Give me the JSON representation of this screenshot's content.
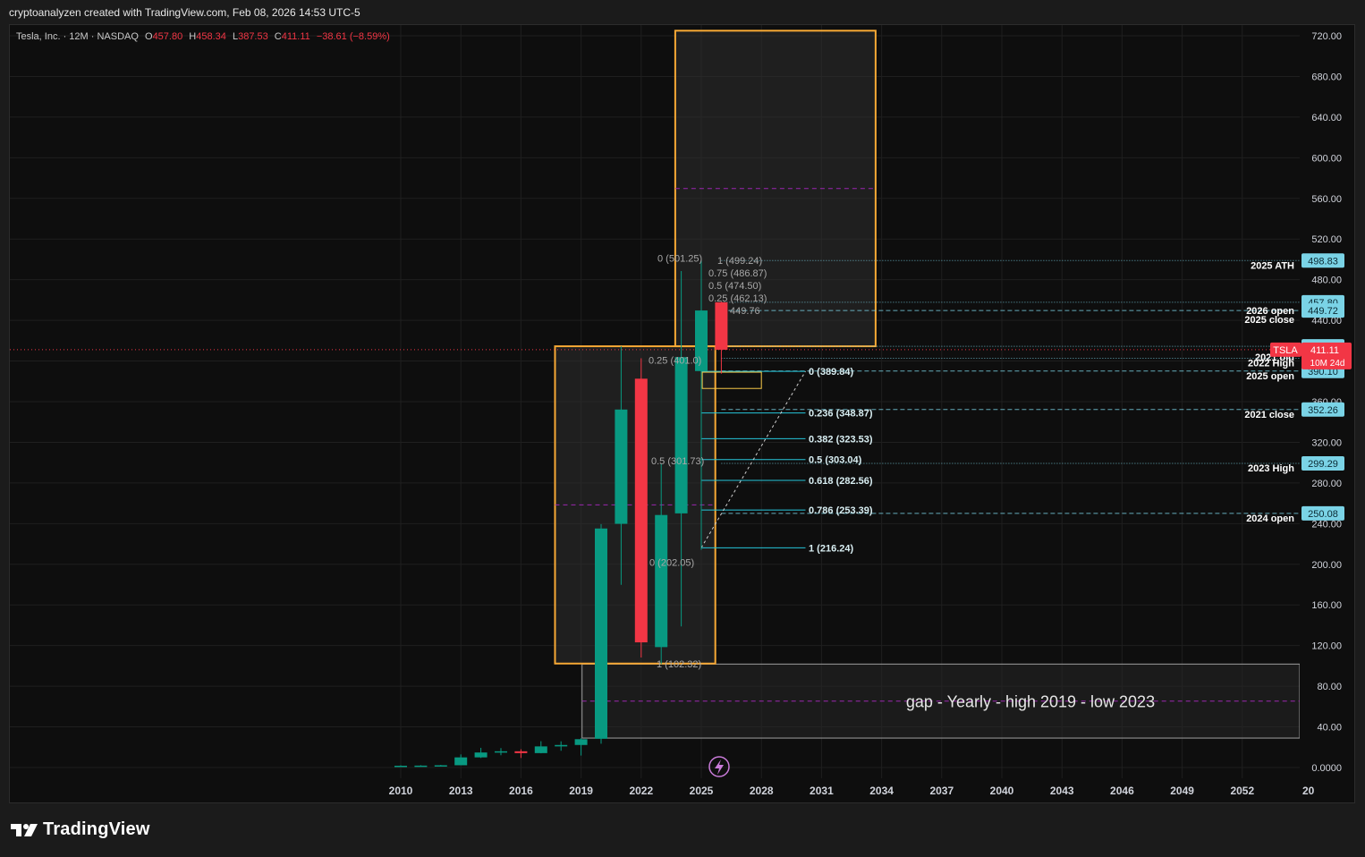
{
  "header": {
    "attribution": "cryptoanalyzen created with TradingView.com, Feb 08, 2026 14:53 UTC-5"
  },
  "legend": {
    "symbol": "Tesla, Inc. · 12M · NASDAQ",
    "o_label": "O",
    "o_value": "457.80",
    "h_label": "H",
    "h_value": "458.34",
    "l_label": "L",
    "l_value": "387.53",
    "c_label": "C",
    "c_value": "411.11",
    "change": "−38.61 (−8.59%)"
  },
  "brand": {
    "name": "TradingView"
  },
  "colors": {
    "up": "#089981",
    "down": "#f23645",
    "box_border": "#f7a935",
    "fib": "#26c6da",
    "label_bg": "#7ad3e6",
    "midline": "#9c27b0"
  },
  "chart_data": {
    "type": "candlestick",
    "x_ticks": [
      "2010",
      "2013",
      "2016",
      "2019",
      "2022",
      "2025",
      "2028",
      "2031",
      "2034",
      "2037",
      "2040",
      "2043",
      "2046",
      "2049",
      "2052",
      "20"
    ],
    "y_ticks": [
      "0.0000",
      "40.00",
      "80.00",
      "120.00",
      "160.00",
      "200.00",
      "240.00",
      "280.00",
      "320.00",
      "360.00",
      "400.00",
      "440.00",
      "480.00",
      "520.00",
      "560.00",
      "600.00",
      "640.00",
      "680.00",
      "720.00"
    ],
    "ylim": [
      0,
      720
    ],
    "candles": [
      {
        "year": 2010,
        "o": 1.27,
        "h": 2.2,
        "l": 1.0,
        "c": 1.77
      },
      {
        "year": 2011,
        "o": 1.77,
        "h": 2.3,
        "l": 1.5,
        "c": 1.9
      },
      {
        "year": 2012,
        "o": 1.9,
        "h": 2.6,
        "l": 1.5,
        "c": 2.25
      },
      {
        "year": 2013,
        "o": 2.25,
        "h": 12.9,
        "l": 2.2,
        "c": 10.0
      },
      {
        "year": 2014,
        "o": 10.0,
        "h": 19.4,
        "l": 9.4,
        "c": 14.8
      },
      {
        "year": 2015,
        "o": 14.8,
        "h": 19.1,
        "l": 12.1,
        "c": 16.0
      },
      {
        "year": 2016,
        "o": 16.0,
        "h": 18.0,
        "l": 9.4,
        "c": 14.2
      },
      {
        "year": 2017,
        "o": 14.2,
        "h": 25.9,
        "l": 14.0,
        "c": 20.8
      },
      {
        "year": 2018,
        "o": 20.8,
        "h": 25.8,
        "l": 16.5,
        "c": 22.2
      },
      {
        "year": 2019,
        "o": 22.2,
        "h": 29.0,
        "l": 11.8,
        "c": 27.9
      },
      {
        "year": 2020,
        "o": 28.3,
        "h": 239.57,
        "l": 23.4,
        "c": 235.2
      },
      {
        "year": 2021,
        "o": 239.8,
        "h": 414.5,
        "l": 179.8,
        "c": 352.26
      },
      {
        "year": 2022,
        "o": 382.6,
        "h": 402.67,
        "l": 108.24,
        "c": 123.18
      },
      {
        "year": 2023,
        "o": 118.5,
        "h": 299.29,
        "l": 101.81,
        "c": 248.48
      },
      {
        "year": 2024,
        "o": 250.08,
        "h": 488.54,
        "l": 138.8,
        "c": 403.84
      },
      {
        "year": 2025,
        "o": 390.1,
        "h": 498.83,
        "l": 214.25,
        "c": 449.72
      },
      {
        "year": 2026,
        "o": 457.8,
        "h": 458.34,
        "l": 387.53,
        "c": 411.11
      }
    ],
    "price_labels": [
      {
        "value": "498.83",
        "price": 498.83,
        "text": "2025 ATH"
      },
      {
        "value": "457.80",
        "price": 457.8,
        "text": ""
      },
      {
        "value": "449.72",
        "price": 449.72,
        "text": "2026 open"
      },
      {
        "value": "414.50",
        "price": 414.5,
        "text": ""
      },
      {
        "value": "402.67",
        "price": 402.67,
        "text": "2022 High"
      },
      {
        "value": "390.10",
        "price": 390.1,
        "text": "2025 open"
      },
      {
        "value": "352.26",
        "price": 352.26,
        "text": "2021 close"
      },
      {
        "value": "299.29",
        "price": 299.29,
        "text": "2023 High"
      },
      {
        "value": "250.08",
        "price": 250.08,
        "text": "2024 open"
      }
    ],
    "extra_labels": [
      {
        "text": "2025 close",
        "price": 441
      },
      {
        "text": "2021 old",
        "price": 404
      }
    ],
    "current": {
      "symbol": "TSLA",
      "price": "411.11",
      "countdown": "10M 24d"
    },
    "fib_main": [
      {
        "text": "0 (389.84)",
        "price": 389.84
      },
      {
        "text": "0.236 (348.87)",
        "price": 348.87
      },
      {
        "text": "0.382 (323.53)",
        "price": 323.53
      },
      {
        "text": "0.5 (303.04)",
        "price": 303.04
      },
      {
        "text": "0.618 (282.56)",
        "price": 282.56
      },
      {
        "text": "0.786 (253.39)",
        "price": 253.39
      },
      {
        "text": "1 (216.24)",
        "price": 216.24
      }
    ],
    "fib_top": [
      {
        "text": "0 (501.25)",
        "price": 501.25
      },
      {
        "text": "1 (499.24)",
        "price": 499.24
      },
      {
        "text": "0.75 (486.87)",
        "price": 486.87
      },
      {
        "text": "0.5 (474.50)",
        "price": 474.5
      },
      {
        "text": "0.25 (462.13)",
        "price": 462.13
      },
      {
        "text": "449.76",
        "price": 449.76
      }
    ],
    "fib_left": [
      {
        "text": "0.25 (401.0)",
        "price": 401
      },
      {
        "text": "0.5 (301.73)",
        "price": 301.73
      },
      {
        "text": "0 (202.05)",
        "price": 202.05
      },
      {
        "text": "1 (102.32)",
        "price": 102.32
      }
    ],
    "boxes": [
      {
        "name": "box-upper",
        "x0": 2023.7,
        "x1": 2033.7,
        "p0": 414.5,
        "p1": 725
      },
      {
        "name": "box-middle",
        "x0": 2017.7,
        "x1": 2025.7,
        "p0": 102.32,
        "p1": 414.5
      }
    ],
    "gap_zone": {
      "text": "gap - Yearly - high 2019 - low 2023",
      "p0": 29.0,
      "p1": 101.81
    }
  }
}
